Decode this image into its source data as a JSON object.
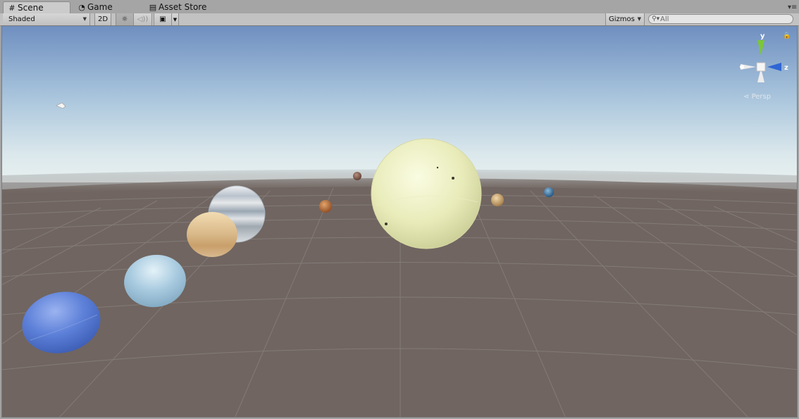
{
  "tabs": [
    {
      "label": "Scene",
      "icon": "grid-icon",
      "active": true
    },
    {
      "label": "Game",
      "icon": "pacman-icon",
      "active": false
    },
    {
      "label": "Asset Store",
      "icon": "store-icon",
      "active": false
    }
  ],
  "toolbar": {
    "shading_mode": "Shaded",
    "mode_2d": "2D",
    "lighting_icon": "sun-icon",
    "audio_icon": "speaker-icon",
    "effects_icon": "image-icon",
    "gizmos_label": "Gizmos",
    "search_placeholder": "All"
  },
  "scene": {
    "sky_top": "#6f8fc0",
    "sky_horizon": "#e8f0f0",
    "ground": "#706560",
    "objects": [
      "sun-sphere",
      "mercury-sphere",
      "venus-sphere",
      "earth-sphere",
      "mars-sphere",
      "jupiter-sphere",
      "saturn-sphere",
      "uranus-sphere",
      "neptune-sphere",
      "pluto-sphere",
      "directional-light"
    ]
  },
  "gizmo": {
    "y_label": "y",
    "z_label": "z",
    "projection_label": "Persp",
    "lock_icon": "lock-icon",
    "y_color": "#7cc63a",
    "z_color": "#2f66d4"
  }
}
